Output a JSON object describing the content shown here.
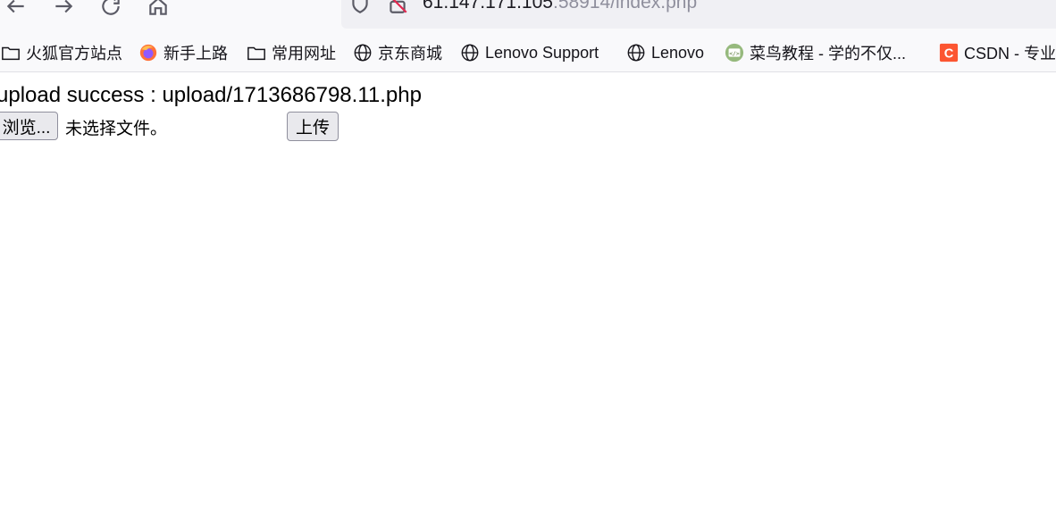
{
  "browser": {
    "url": {
      "host": "61.147.171.105",
      "rest": ":58914/index.php"
    },
    "nav_icons": [
      "back-arrow-icon",
      "forward-arrow-icon",
      "reload-icon",
      "home-icon"
    ],
    "url_icons": [
      "shield-icon",
      "insecure-lock-icon"
    ]
  },
  "bookmarks": {
    "items": [
      {
        "label": "火狐官方站点",
        "icon": "folder-icon"
      },
      {
        "label": "新手上路",
        "icon": "firefox-icon"
      },
      {
        "label": "常用网址",
        "icon": "folder-icon"
      },
      {
        "label": "京东商城",
        "icon": "globe-icon"
      },
      {
        "label": "Lenovo Support",
        "icon": "globe-icon"
      },
      {
        "label": "Lenovo",
        "icon": "globe-icon"
      },
      {
        "label": "菜鸟教程 - 学的不仅...",
        "icon": "runoob-icon"
      },
      {
        "label": "CSDN - 专业",
        "icon": "csdn-icon"
      }
    ]
  },
  "page": {
    "status_text": "upload success : upload/1713686798.11.php",
    "browse_label": "浏览...",
    "file_status": "未选择文件。",
    "upload_label": "上传"
  },
  "colors": {
    "toolbar_bg": "#f9f9fb",
    "urlbar_bg": "#f0f0f4",
    "button_bg": "#e9e9ed",
    "csdn_red": "#fc5531",
    "runoob_green": "#96b97d"
  }
}
